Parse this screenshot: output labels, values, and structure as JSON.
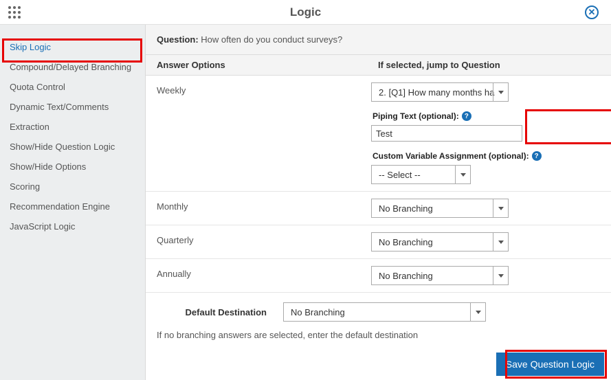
{
  "header": {
    "title": "Logic"
  },
  "sidebar": {
    "items": [
      "Skip Logic",
      "Compound/Delayed Branching",
      "Quota Control",
      "Dynamic Text/Comments",
      "Extraction",
      "Show/Hide Question Logic",
      "Show/Hide Options",
      "Scoring",
      "Recommendation Engine",
      "JavaScript Logic"
    ]
  },
  "question": {
    "label": "Question:",
    "text": "How often do you conduct surveys?"
  },
  "columns": {
    "a": "Answer Options",
    "b": "If selected, jump to Question"
  },
  "weekly": {
    "label": "Weekly",
    "select": "2. [Q1] How many months ha",
    "piping_label": "Piping Text (optional):",
    "piping_value": "Test",
    "cva_label": "Custom Variable Assignment (optional):",
    "cva_select": "-- Select --"
  },
  "monthly": {
    "label": "Monthly",
    "select": "No Branching"
  },
  "quarterly": {
    "label": "Quarterly",
    "select": "No Branching"
  },
  "annually": {
    "label": "Annually",
    "select": "No Branching"
  },
  "default_dest": {
    "label": "Default Destination",
    "select": "No Branching"
  },
  "hint": "If no branching answers are selected, enter the default destination",
  "save": "Save Question Logic"
}
